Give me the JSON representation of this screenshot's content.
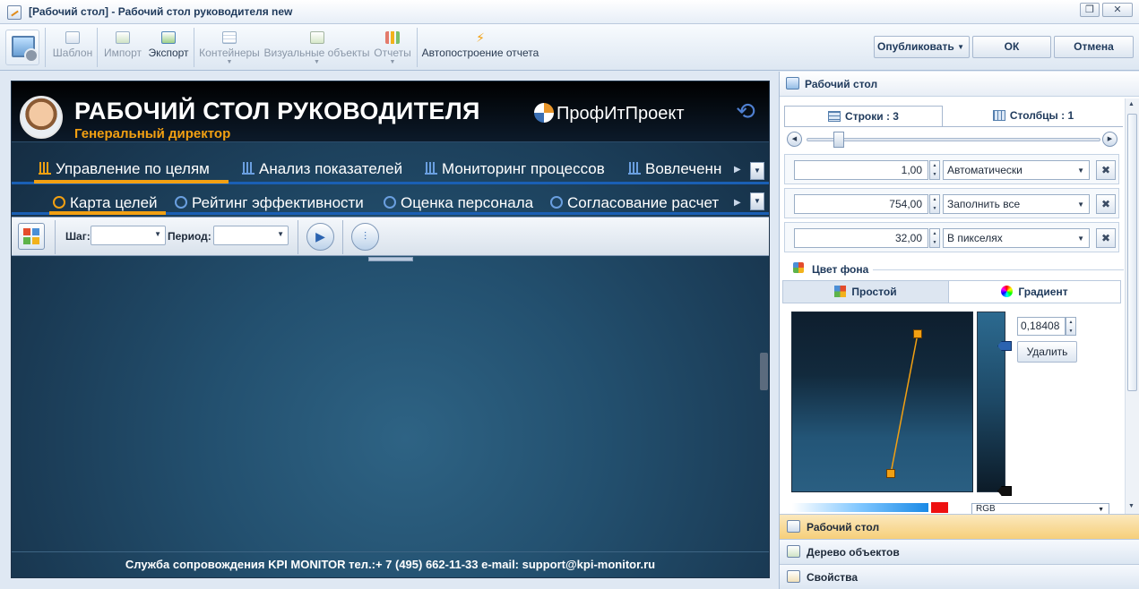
{
  "window": {
    "title": "[Рабочий стол] - Рабочий стол руководителя new"
  },
  "ribbon": {
    "template": "Шаблон",
    "import": "Импорт",
    "export": "Экспорт",
    "containers": "Контейнеры",
    "visual_objects": "Визуальные объекты",
    "reports": "Отчеты",
    "auto_report": "Автопостроение отчета",
    "publish": "Опубликовать",
    "ok": "ОК",
    "cancel": "Отмена"
  },
  "dashboard": {
    "title": "РАБОЧИЙ СТОЛ РУКОВОДИТЕЛЯ",
    "subtitle": "Генеральный директор",
    "brand": "ПрофИтПроект",
    "nav1": [
      "Управление по целям",
      "Анализ показателей",
      "Мониторинг процессов",
      "Вовлеченн"
    ],
    "nav2": [
      "Карта целей",
      "Рейтинг эффективности",
      "Оценка персонала",
      "Согласование расчет"
    ],
    "filter": {
      "step_label": "Шаг:",
      "period_label": "Период:"
    },
    "footer": "Служба сопровождения KPI MONITOR тел.:+ 7 (495) 662-11-33 e-mail: support@kpi-monitor.ru"
  },
  "panel": {
    "header": "Рабочий стол",
    "tabs": {
      "rows": "Строки : 3",
      "cols": "Столбцы : 1"
    },
    "rows": [
      {
        "value": "1,00",
        "mode": "Автоматически"
      },
      {
        "value": "754,00",
        "mode": "Заполнить все"
      },
      {
        "value": "32,00",
        "mode": "В пикселях"
      }
    ],
    "bg_color": "Цвет фона",
    "color_tabs": {
      "simple": "Простой",
      "gradient": "Градиент"
    },
    "gradient": {
      "position": "0,18408",
      "remove": "Удалить",
      "color_model": "RGB"
    },
    "accordion": [
      "Рабочий стол",
      "Дерево объектов",
      "Свойства"
    ]
  },
  "colors": {
    "accent_orange": "#f2a012",
    "nav_blue": "#1a5fb4",
    "selected_accordion": "#f6cf7a"
  }
}
